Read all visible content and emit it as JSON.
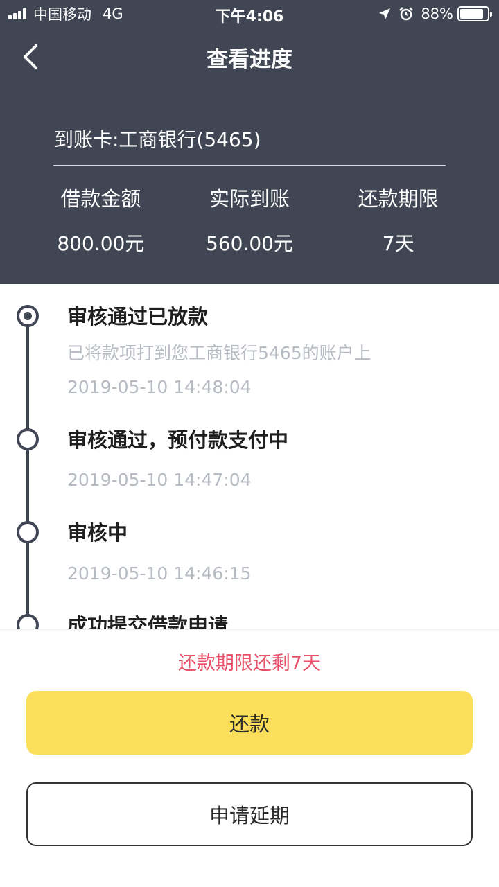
{
  "status_bar": {
    "carrier": "中国移动",
    "network": "4G",
    "time": "下午4:06",
    "battery": "88%",
    "battery_level": 0.88
  },
  "nav": {
    "title": "查看进度",
    "back_icon": "chevron-left-icon"
  },
  "summary": {
    "card": "到账卡:工商银行(5465)",
    "stats": [
      {
        "label": "借款金额",
        "value": "800.00元"
      },
      {
        "label": "实际到账",
        "value": "560.00元"
      },
      {
        "label": "还款期限",
        "value": "7天"
      }
    ]
  },
  "timeline": [
    {
      "title": "审核通过已放款",
      "desc": "已将款项打到您工商银行5465的账户上",
      "time": "2019-05-10 14:48:04",
      "active": true
    },
    {
      "title": "审核通过，预付款支付中",
      "desc": "",
      "time": "2019-05-10 14:47:04",
      "active": false
    },
    {
      "title": "审核中",
      "desc": "",
      "time": "2019-05-10 14:46:15",
      "active": false
    },
    {
      "title": "成功提交借款申请",
      "desc": "",
      "time": "",
      "active": false
    }
  ],
  "bottom": {
    "remaining": "还款期限还剩7天",
    "repay_label": "还款",
    "extend_label": "申请延期"
  },
  "colors": {
    "header_bg": "#414655",
    "accent_yellow": "#fbdf5a",
    "warning_red": "#e8516a",
    "muted_text": "#b6bac2"
  }
}
